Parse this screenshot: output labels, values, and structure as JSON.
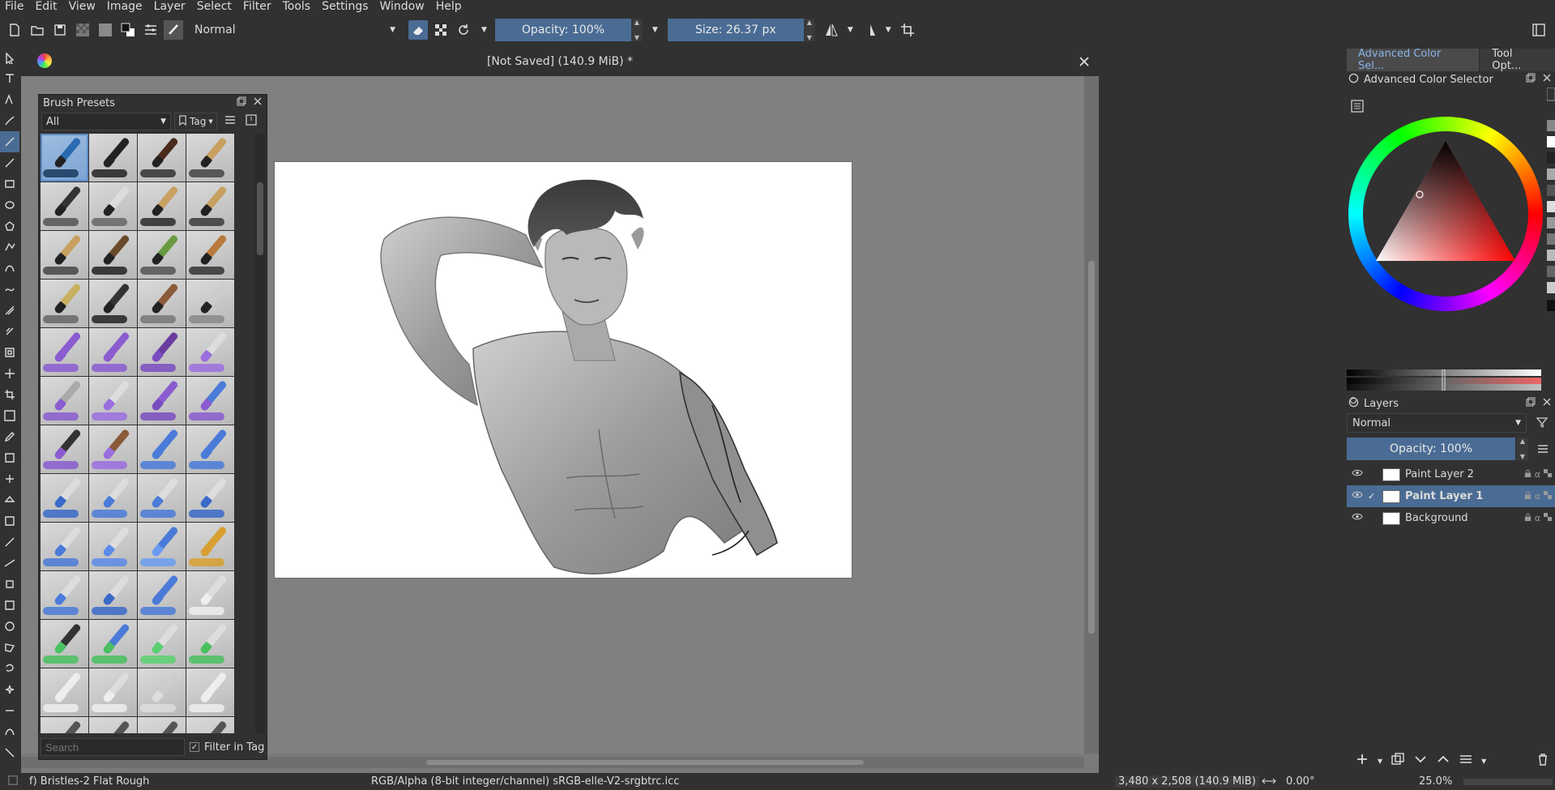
{
  "menu": [
    "File",
    "Edit",
    "View",
    "Image",
    "Layer",
    "Select",
    "Filter",
    "Tools",
    "Settings",
    "Window",
    "Help"
  ],
  "toolbar": {
    "blend_mode": "Normal",
    "opacity": "Opacity: 100%",
    "size": "Size: 26.37 px"
  },
  "document": {
    "title": "[Not Saved]  (140.9 MiB) *"
  },
  "brush_presets": {
    "title": "Brush Presets",
    "filter": "All",
    "tag_label": "Tag",
    "search_placeholder": "Search",
    "filter_in_tag": "Filter in Tag"
  },
  "right_dock": {
    "tabs": [
      "Advanced Color Sel...",
      "Tool Opt..."
    ],
    "color_selector_title": "Advanced Color Selector",
    "layers_title": "Layers",
    "layers_blend": "Normal",
    "layers_opacity": "Opacity:  100%",
    "layers": [
      {
        "name": "Paint Layer 2",
        "selected": false
      },
      {
        "name": "Paint Layer 1",
        "selected": true
      },
      {
        "name": "Background",
        "selected": false
      }
    ]
  },
  "status": {
    "brush": "f) Bristles-2 Flat Rough",
    "color_space": "RGB/Alpha (8-bit integer/channel)  sRGB-elle-V2-srgbtrc.icc",
    "dimensions": "3,480 x 2,508 (140.9 MiB)",
    "rotation": "0.00°",
    "zoom": "25.0%"
  },
  "colors": {
    "accent": "#4a6c94",
    "panel": "#313131",
    "canvas_bg": "#808080"
  }
}
